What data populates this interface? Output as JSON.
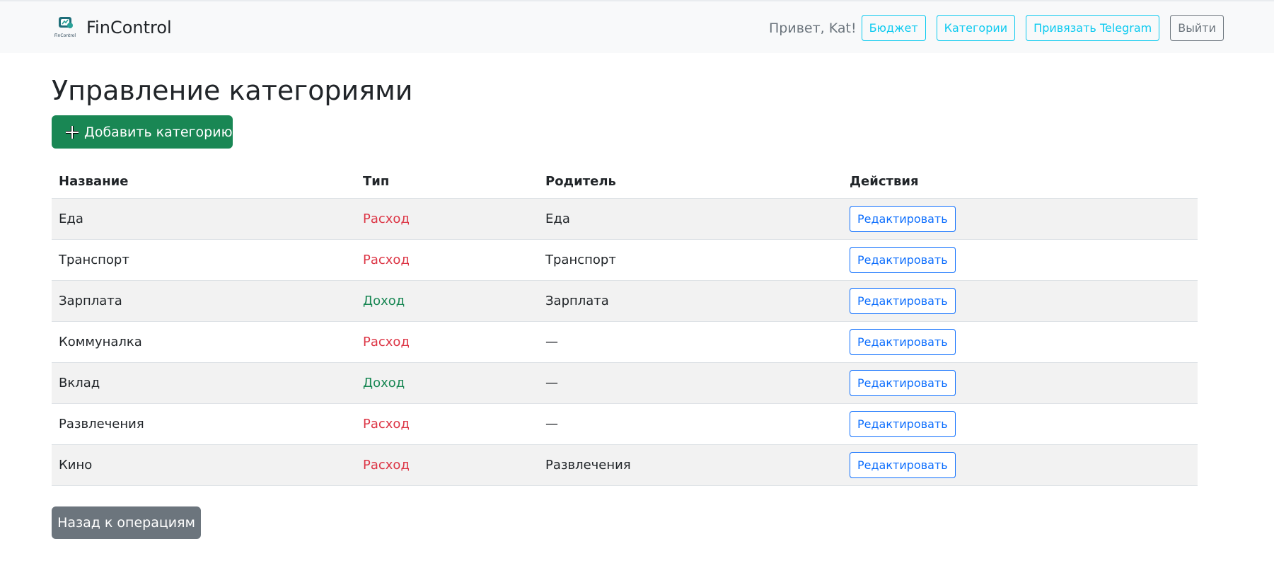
{
  "navbar": {
    "brand_name": "FinControl",
    "logo_text": "FinControl",
    "greeting": "Привет, Kat!",
    "links": [
      {
        "label": "Бюджет"
      },
      {
        "label": "Категории"
      },
      {
        "label": "Привязать Telegram"
      }
    ],
    "logout_label": "Выйти"
  },
  "page": {
    "title": "Управление категориями",
    "add_button_label": "Добавить категорию",
    "back_button_label": "Назад к операциям"
  },
  "table": {
    "headers": [
      "Название",
      "Тип",
      "Родитель",
      "Действия"
    ],
    "rows": [
      {
        "name": "Еда",
        "type": "Расход",
        "type_kind": "expense",
        "parent": "Еда",
        "action": "Редактировать"
      },
      {
        "name": "Транспорт",
        "type": "Расход",
        "type_kind": "expense",
        "parent": "Транспорт",
        "action": "Редактировать"
      },
      {
        "name": "Зарплата",
        "type": "Доход",
        "type_kind": "income",
        "parent": "Зарплата",
        "action": "Редактировать"
      },
      {
        "name": "Коммуналка",
        "type": "Расход",
        "type_kind": "expense",
        "parent": "—",
        "action": "Редактировать"
      },
      {
        "name": "Вклад",
        "type": "Доход",
        "type_kind": "income",
        "parent": "—",
        "action": "Редактировать"
      },
      {
        "name": "Развлечения",
        "type": "Расход",
        "type_kind": "expense",
        "parent": "—",
        "action": "Редактировать"
      },
      {
        "name": "Кино",
        "type": "Расход",
        "type_kind": "expense",
        "parent": "Развлечения",
        "action": "Редактировать"
      }
    ]
  },
  "colors": {
    "success": "#198754",
    "danger": "#dc3545",
    "info": "#0dcaf0",
    "primary": "#0d6efd",
    "secondary": "#6c757d"
  },
  "icons": {
    "logo": "fincontrol-logo-icon",
    "add": "plus-icon"
  }
}
